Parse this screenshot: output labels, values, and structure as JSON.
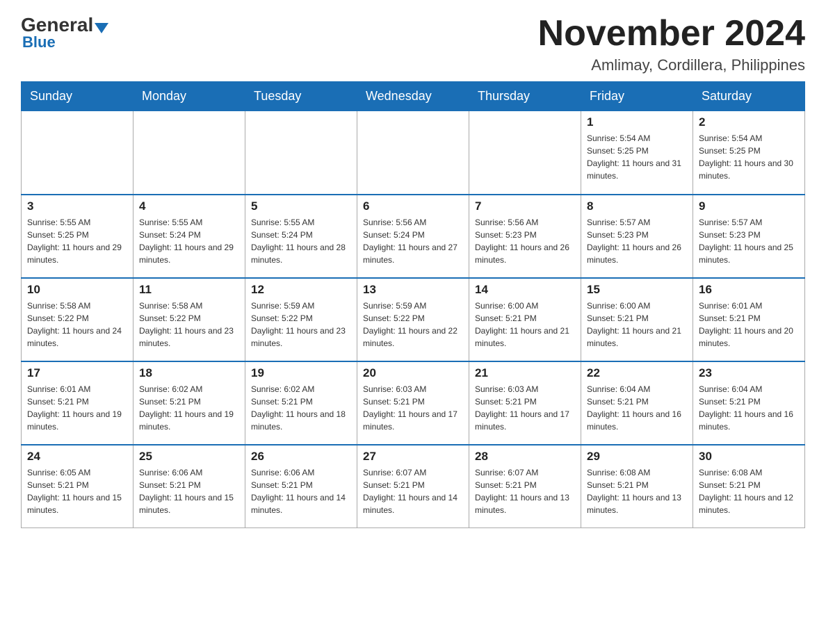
{
  "logo": {
    "general": "General",
    "blue": "Blue"
  },
  "header": {
    "month": "November 2024",
    "location": "Amlimay, Cordillera, Philippines"
  },
  "weekdays": [
    "Sunday",
    "Monday",
    "Tuesday",
    "Wednesday",
    "Thursday",
    "Friday",
    "Saturday"
  ],
  "weeks": [
    [
      {
        "day": "",
        "info": ""
      },
      {
        "day": "",
        "info": ""
      },
      {
        "day": "",
        "info": ""
      },
      {
        "day": "",
        "info": ""
      },
      {
        "day": "",
        "info": ""
      },
      {
        "day": "1",
        "info": "Sunrise: 5:54 AM\nSunset: 5:25 PM\nDaylight: 11 hours and 31 minutes."
      },
      {
        "day": "2",
        "info": "Sunrise: 5:54 AM\nSunset: 5:25 PM\nDaylight: 11 hours and 30 minutes."
      }
    ],
    [
      {
        "day": "3",
        "info": "Sunrise: 5:55 AM\nSunset: 5:25 PM\nDaylight: 11 hours and 29 minutes."
      },
      {
        "day": "4",
        "info": "Sunrise: 5:55 AM\nSunset: 5:24 PM\nDaylight: 11 hours and 29 minutes."
      },
      {
        "day": "5",
        "info": "Sunrise: 5:55 AM\nSunset: 5:24 PM\nDaylight: 11 hours and 28 minutes."
      },
      {
        "day": "6",
        "info": "Sunrise: 5:56 AM\nSunset: 5:24 PM\nDaylight: 11 hours and 27 minutes."
      },
      {
        "day": "7",
        "info": "Sunrise: 5:56 AM\nSunset: 5:23 PM\nDaylight: 11 hours and 26 minutes."
      },
      {
        "day": "8",
        "info": "Sunrise: 5:57 AM\nSunset: 5:23 PM\nDaylight: 11 hours and 26 minutes."
      },
      {
        "day": "9",
        "info": "Sunrise: 5:57 AM\nSunset: 5:23 PM\nDaylight: 11 hours and 25 minutes."
      }
    ],
    [
      {
        "day": "10",
        "info": "Sunrise: 5:58 AM\nSunset: 5:22 PM\nDaylight: 11 hours and 24 minutes."
      },
      {
        "day": "11",
        "info": "Sunrise: 5:58 AM\nSunset: 5:22 PM\nDaylight: 11 hours and 23 minutes."
      },
      {
        "day": "12",
        "info": "Sunrise: 5:59 AM\nSunset: 5:22 PM\nDaylight: 11 hours and 23 minutes."
      },
      {
        "day": "13",
        "info": "Sunrise: 5:59 AM\nSunset: 5:22 PM\nDaylight: 11 hours and 22 minutes."
      },
      {
        "day": "14",
        "info": "Sunrise: 6:00 AM\nSunset: 5:21 PM\nDaylight: 11 hours and 21 minutes."
      },
      {
        "day": "15",
        "info": "Sunrise: 6:00 AM\nSunset: 5:21 PM\nDaylight: 11 hours and 21 minutes."
      },
      {
        "day": "16",
        "info": "Sunrise: 6:01 AM\nSunset: 5:21 PM\nDaylight: 11 hours and 20 minutes."
      }
    ],
    [
      {
        "day": "17",
        "info": "Sunrise: 6:01 AM\nSunset: 5:21 PM\nDaylight: 11 hours and 19 minutes."
      },
      {
        "day": "18",
        "info": "Sunrise: 6:02 AM\nSunset: 5:21 PM\nDaylight: 11 hours and 19 minutes."
      },
      {
        "day": "19",
        "info": "Sunrise: 6:02 AM\nSunset: 5:21 PM\nDaylight: 11 hours and 18 minutes."
      },
      {
        "day": "20",
        "info": "Sunrise: 6:03 AM\nSunset: 5:21 PM\nDaylight: 11 hours and 17 minutes."
      },
      {
        "day": "21",
        "info": "Sunrise: 6:03 AM\nSunset: 5:21 PM\nDaylight: 11 hours and 17 minutes."
      },
      {
        "day": "22",
        "info": "Sunrise: 6:04 AM\nSunset: 5:21 PM\nDaylight: 11 hours and 16 minutes."
      },
      {
        "day": "23",
        "info": "Sunrise: 6:04 AM\nSunset: 5:21 PM\nDaylight: 11 hours and 16 minutes."
      }
    ],
    [
      {
        "day": "24",
        "info": "Sunrise: 6:05 AM\nSunset: 5:21 PM\nDaylight: 11 hours and 15 minutes."
      },
      {
        "day": "25",
        "info": "Sunrise: 6:06 AM\nSunset: 5:21 PM\nDaylight: 11 hours and 15 minutes."
      },
      {
        "day": "26",
        "info": "Sunrise: 6:06 AM\nSunset: 5:21 PM\nDaylight: 11 hours and 14 minutes."
      },
      {
        "day": "27",
        "info": "Sunrise: 6:07 AM\nSunset: 5:21 PM\nDaylight: 11 hours and 14 minutes."
      },
      {
        "day": "28",
        "info": "Sunrise: 6:07 AM\nSunset: 5:21 PM\nDaylight: 11 hours and 13 minutes."
      },
      {
        "day": "29",
        "info": "Sunrise: 6:08 AM\nSunset: 5:21 PM\nDaylight: 11 hours and 13 minutes."
      },
      {
        "day": "30",
        "info": "Sunrise: 6:08 AM\nSunset: 5:21 PM\nDaylight: 11 hours and 12 minutes."
      }
    ]
  ]
}
